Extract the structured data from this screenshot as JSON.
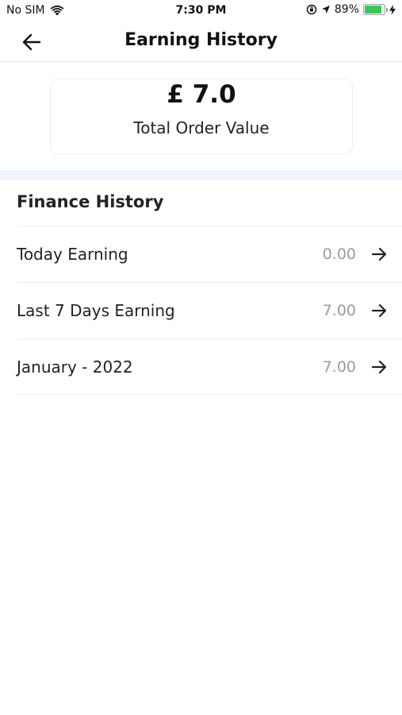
{
  "status_bar": {
    "carrier": "No SIM",
    "time": "7:30 PM",
    "battery_percent": "89%",
    "battery_level": 0.89,
    "icons": [
      "wifi-icon",
      "orientation-lock-icon",
      "location-arrow-icon",
      "battery-icon",
      "charging-bolt-icon"
    ]
  },
  "header": {
    "title": "Earning History",
    "back_icon": "arrow-left-icon"
  },
  "summary": {
    "amount": "£ 7.0",
    "label": "Total Order Value"
  },
  "finance": {
    "section_title": "Finance History",
    "items": [
      {
        "label": "Today Earning",
        "value": "0.00"
      },
      {
        "label": "Last 7 Days Earning",
        "value": "7.00"
      },
      {
        "label": "January - 2022",
        "value": "7.00"
      }
    ]
  },
  "colors": {
    "accent_band": "#f1f4fb",
    "battery_fill": "#35c759",
    "value_text": "#9b9b9b"
  }
}
